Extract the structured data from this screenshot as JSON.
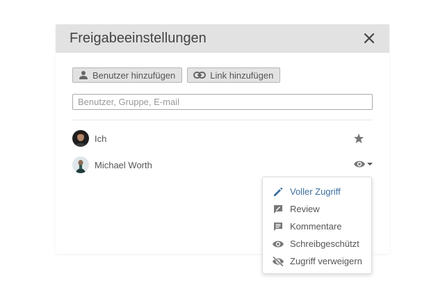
{
  "dialog": {
    "title": "Freigabeeinstellungen",
    "close_icon": "close-icon"
  },
  "toolbar": {
    "add_user_label": "Benutzer hinzufügen",
    "add_user_icon": "person-icon",
    "add_link_label": "Link hinzufügen",
    "add_link_icon": "link-icon"
  },
  "search": {
    "placeholder": "Benutzer, Gruppe, E-mail",
    "value": ""
  },
  "users": [
    {
      "name": "Ich",
      "right_icon": "star-icon"
    },
    {
      "name": "Michael Worth",
      "right_icon": "eye-icon"
    }
  ],
  "permission_menu": {
    "items": [
      {
        "label": "Voller Zugriff",
        "icon": "pencil-icon",
        "selected": true
      },
      {
        "label": "Review",
        "icon": "review-icon"
      },
      {
        "label": "Kommentare",
        "icon": "comment-icon"
      },
      {
        "label": "Schreibgeschützt",
        "icon": "eye-icon"
      },
      {
        "label": "Zugriff verweigern",
        "icon": "eye-off-icon"
      }
    ]
  },
  "colors": {
    "header_bg": "#e2e2e2",
    "accent": "#3c6e9e",
    "icon_gray": "#777777"
  }
}
